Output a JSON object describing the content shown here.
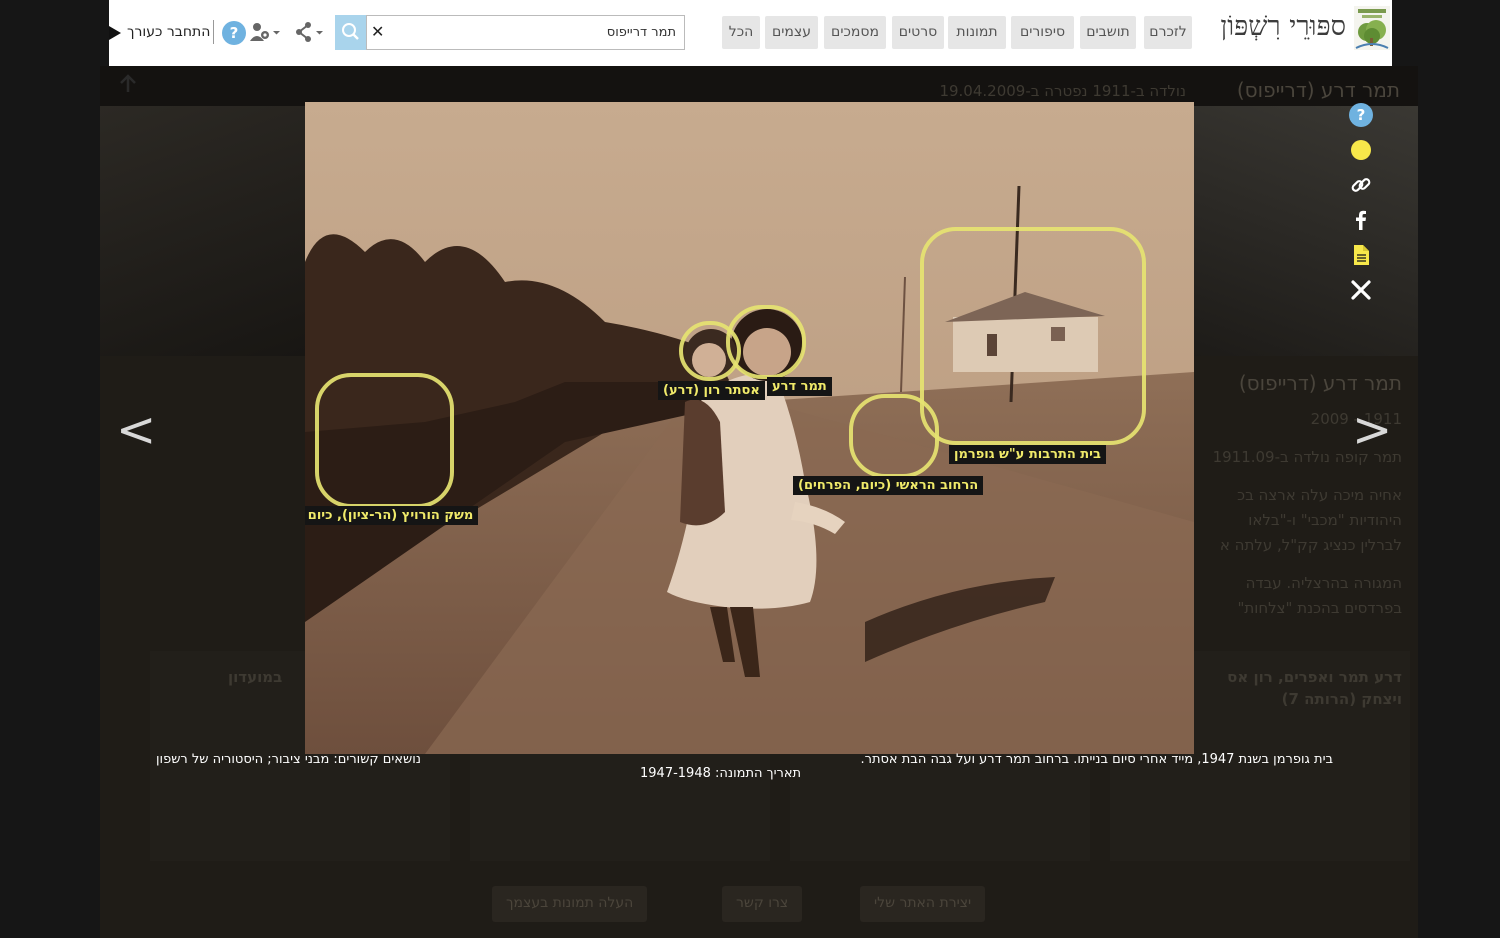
{
  "site": {
    "logo_text": "ספּוּרֵי רִשְׁפּוֹן"
  },
  "nav": {
    "items": [
      {
        "label": "לזכרם"
      },
      {
        "label": "תושבים"
      },
      {
        "label": "סיפורים"
      },
      {
        "label": "תמונות"
      },
      {
        "label": "סרטים"
      },
      {
        "label": "מסמכים"
      },
      {
        "label": "עצמים"
      },
      {
        "label": "הכל"
      }
    ]
  },
  "search": {
    "value": "תמר דרייפוס"
  },
  "user": {
    "login_label": "התחבר כעורך"
  },
  "icons": {
    "search": "search-icon",
    "clear": "close-icon",
    "share": "share-icon",
    "users": "users-settings-icon",
    "help": "question-circle-icon",
    "login": "arrow-icon"
  },
  "background_page": {
    "header_title": "תמר דרע (דרייפוס)",
    "header_dates": "נולדה ב-1911 נפטרה ב-19.04.2009",
    "person_title": "תמר דרע (דרייפוס)",
    "person_years": "1911 - 2009",
    "bio_lines": [
      "תמר קופה נולדה ב-1911.09",
      "אחיה מיכה עלה ארצה בכ",
      "היהודיות \"מכבי\" ו-\"בלאו",
      "לברלין כנציג קק\"ל, עלתה א",
      "המגורה בהרצליה. עבדה",
      "בפרדסים בהכנת \"צלחות\""
    ],
    "card_right_title": "דרע תמר ואפרים, רון אס",
    "card_right_subtitle": "ויצחק (הרותה 7)",
    "card_left_title": "במועדון",
    "buttons": [
      "יצירת האתר שלי",
      "צרו קשר",
      "העלה תמונות בעצמך"
    ]
  },
  "lightbox": {
    "tags": [
      {
        "label": "משק הורויץ (הר-ציון), כיום להן"
      },
      {
        "label": "אסתר רון (דרע)"
      },
      {
        "label": "תמר דרע"
      },
      {
        "label": "הרחוב הראשי (כיום, הפרחים)"
      },
      {
        "label": "בית התרבות ע\"ש גופרמן"
      }
    ],
    "caption_description": "בית גופרמן בשנת 1947, מייד אחרי סיום בנייתו. ברחוב תמר דרע ועל גבה הבת אסתר.",
    "caption_date": "תאריך התמונה: 1947-1948",
    "caption_topics": "נושאים קשורים: מבני ציבור; היסטוריה של רשפון",
    "prev_arrow": "<",
    "next_arrow": ">"
  },
  "side_tools": [
    "question-circle-icon",
    "yellow-dot-icon",
    "link-icon",
    "facebook-icon",
    "document-icon",
    "close-icon"
  ],
  "colors": {
    "accent_yellow": "#e6e371",
    "tag_text": "#f0ea6a",
    "help_blue": "#6fb2e0",
    "search_button": "#a9d4ec",
    "topbar_bg": "#ffffff"
  }
}
